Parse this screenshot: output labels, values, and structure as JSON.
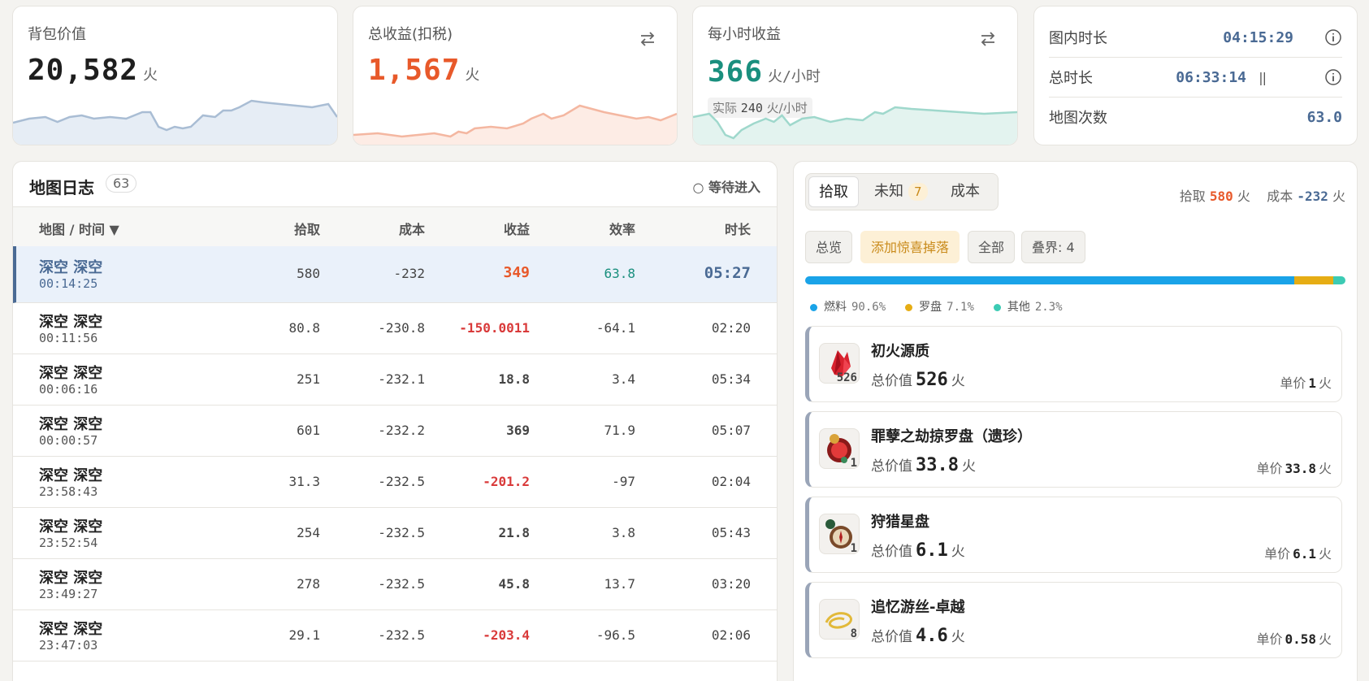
{
  "stats": {
    "bag_value": {
      "title": "背包价值",
      "value": "20,582",
      "unit": "火"
    },
    "total_income": {
      "title": "总收益(扣税)",
      "value": "1,567",
      "unit": "火"
    },
    "hourly_income": {
      "title": "每小时收益",
      "value": "366",
      "unit": "火/小时",
      "actual_label": "实际",
      "actual_value": "240",
      "actual_unit": "火/小时"
    },
    "time": {
      "in_map_label": "图内时长",
      "in_map_value": "04:15:29",
      "total_label": "总时长",
      "total_value": "06:33:14",
      "pause_glyph": "||",
      "map_count_label": "地图次数",
      "map_count_value": "63.0"
    }
  },
  "colors": {
    "accent_blue": "#4a6a94",
    "orange": "#e8592a",
    "red": "#d93a3a",
    "teal": "#1a8f7e",
    "fuel": "#1aa3e8",
    "compass": "#e6ad14",
    "other": "#3ccbb4"
  },
  "log": {
    "title": "地图日志",
    "count": "63",
    "waiting": "○ 等待进入",
    "columns": [
      "地图 / 时间 ▼",
      "拾取",
      "成本",
      "收益",
      "效率",
      "时长"
    ],
    "rows": [
      {
        "name": "深空 深空",
        "time": "00:14:25",
        "pickup": "580",
        "cost": "-232",
        "income": "349",
        "eff": "63.8",
        "dur": "05:27"
      },
      {
        "name": "深空 深空",
        "time": "00:11:56",
        "pickup": "80.8",
        "cost": "-230.8",
        "income": "-150.0011",
        "eff": "-64.1",
        "dur": "02:20"
      },
      {
        "name": "深空 深空",
        "time": "00:06:16",
        "pickup": "251",
        "cost": "-232.1",
        "income": "18.8",
        "eff": "3.4",
        "dur": "05:34"
      },
      {
        "name": "深空 深空",
        "time": "00:00:57",
        "pickup": "601",
        "cost": "-232.2",
        "income": "369",
        "eff": "71.9",
        "dur": "05:07"
      },
      {
        "name": "深空 深空",
        "time": "23:58:43",
        "pickup": "31.3",
        "cost": "-232.5",
        "income": "-201.2",
        "eff": "-97",
        "dur": "02:04"
      },
      {
        "name": "深空 深空",
        "time": "23:52:54",
        "pickup": "254",
        "cost": "-232.5",
        "income": "21.8",
        "eff": "3.8",
        "dur": "05:43"
      },
      {
        "name": "深空 深空",
        "time": "23:49:27",
        "pickup": "278",
        "cost": "-232.5",
        "income": "45.8",
        "eff": "13.7",
        "dur": "03:20"
      },
      {
        "name": "深空 深空",
        "time": "23:47:03",
        "pickup": "29.1",
        "cost": "-232.5",
        "income": "-203.4",
        "eff": "-96.5",
        "dur": "02:06"
      }
    ]
  },
  "loot": {
    "tabs": [
      "拾取",
      "未知",
      "成本"
    ],
    "unknown_badge": "7",
    "summary": {
      "pickup_label": "拾取",
      "pickup_value": "580",
      "cost_label": "成本",
      "cost_value": "-232",
      "unit": "火"
    },
    "chips": [
      "总览",
      "添加惊喜掉落",
      "全部",
      "叠界: 4"
    ],
    "legend": [
      {
        "name": "燃料",
        "pct": "90.6%",
        "share": 0.906
      },
      {
        "name": "罗盘",
        "pct": "7.1%",
        "share": 0.071
      },
      {
        "name": "其他",
        "pct": "2.3%",
        "share": 0.023
      }
    ],
    "total_label": "总价值",
    "unit_label": "单价",
    "currency": "火",
    "items": [
      {
        "name": "初火源质",
        "qty": "526",
        "total": "526",
        "unit_price": "1",
        "icon": "crystal-icon"
      },
      {
        "name": "罪孽之劫掠罗盘（遗珍）",
        "qty": "1",
        "total": "33.8",
        "unit_price": "33.8",
        "icon": "compass-icon"
      },
      {
        "name": "狩猎星盘",
        "qty": "1",
        "total": "6.1",
        "unit_price": "6.1",
        "icon": "astrolabe-icon"
      },
      {
        "name": "追忆游丝-卓越",
        "qty": "8",
        "total": "4.6",
        "unit_price": "0.58",
        "icon": "thread-icon"
      }
    ]
  }
}
